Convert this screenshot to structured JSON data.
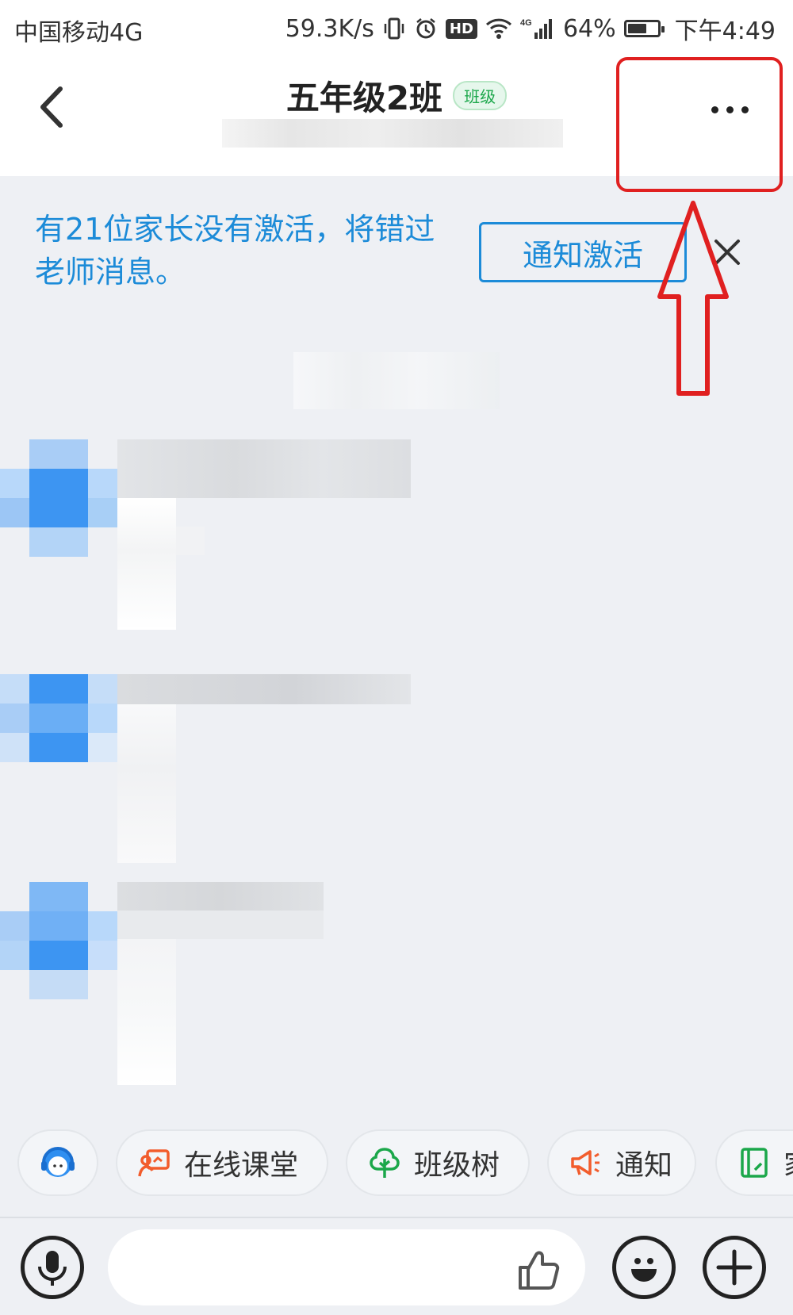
{
  "status_bar": {
    "carrier": "中国移动4G",
    "speed": "59.3K/s",
    "hd": "HD",
    "network": "4G",
    "battery": "64%",
    "battery_level": 0.64,
    "time": "下午4:49"
  },
  "header": {
    "title": "五年级2班",
    "badge": "班级"
  },
  "notice": {
    "text": "有21位家长没有激活，将错过老师消息。",
    "button": "通知激活"
  },
  "quick_bar": [
    {
      "icon": "customer-service-icon",
      "label": ""
    },
    {
      "icon": "online-class-icon",
      "label": "在线课堂"
    },
    {
      "icon": "class-tree-icon",
      "label": "班级树"
    },
    {
      "icon": "megaphone-icon",
      "label": "通知"
    },
    {
      "icon": "homework-icon",
      "label": "家"
    }
  ],
  "input": {
    "placeholder": ""
  },
  "colors": {
    "accent_blue": "#1c8bd8",
    "annotation_red": "#e02020",
    "badge_green": "#1ba74a",
    "orange": "#f25c2c"
  }
}
